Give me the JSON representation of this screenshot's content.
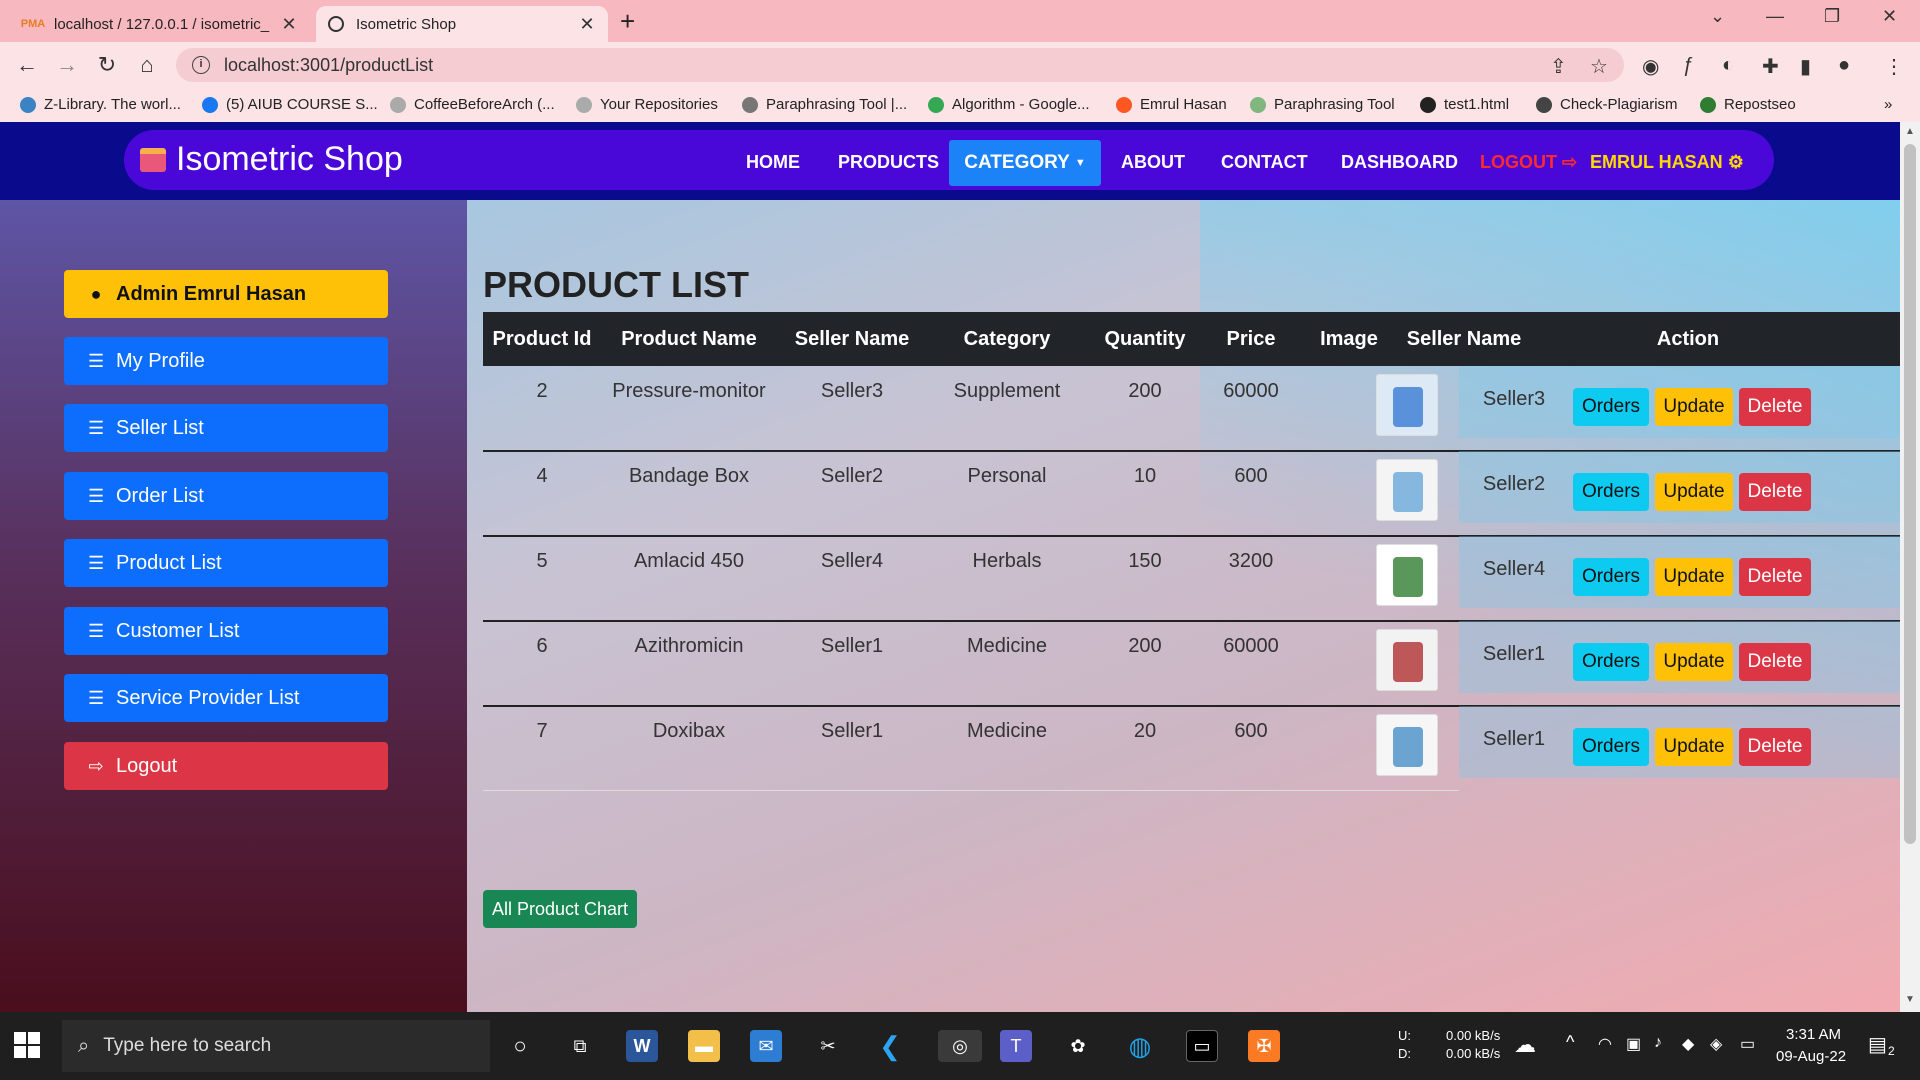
{
  "browser": {
    "tabs": [
      {
        "label": "localhost / 127.0.0.1 / isometric_",
        "favicon": "phpmyadmin-icon"
      },
      {
        "label": "Isometric Shop",
        "favicon": "react-icon"
      }
    ],
    "url": "localhost:3001/productList",
    "bookmarks": [
      {
        "label": "Z-Library. The worl...",
        "color": "#3b83c4"
      },
      {
        "label": "(5) AIUB COURSE S...",
        "color": "#1877f2"
      },
      {
        "label": "CoffeeBeforeArch (...",
        "color": "#aaaaaa"
      },
      {
        "label": "Your Repositories",
        "color": "#aaaaaa"
      },
      {
        "label": "Paraphrasing Tool |...",
        "color": "#777777"
      },
      {
        "label": "Algorithm - Google...",
        "color": "#34a853"
      },
      {
        "label": "Emrul Hasan",
        "color": "#ff5722"
      },
      {
        "label": "Paraphrasing Tool",
        "color": "#7fb77e"
      },
      {
        "label": "test1.html",
        "color": "#222222"
      },
      {
        "label": "Check-Plagiarism",
        "color": "#444444"
      },
      {
        "label": "Repostseo",
        "color": "#2e7d32"
      }
    ]
  },
  "site": {
    "brand": "Isometric Shop",
    "nav": {
      "home": "HOME",
      "products": "PRODUCTS",
      "category": "CATEGORY",
      "about": "ABOUT",
      "contact": "CONTACT",
      "dashboard": "DASHBOARD",
      "logout": "LOGOUT",
      "user": "EMRUL HASAN"
    }
  },
  "sidebar": {
    "admin": "Admin Emrul Hasan",
    "items": [
      "My Profile",
      "Seller List",
      "Order List",
      "Product List",
      "Customer List",
      "Service Provider List"
    ],
    "logout": "Logout"
  },
  "main": {
    "title": "PRODUCT LIST",
    "headers": [
      "Product Id",
      "Product Name",
      "Seller Name",
      "Category",
      "Quantity",
      "Price",
      "Image",
      "Seller Name",
      "Action"
    ],
    "rows": [
      {
        "id": "2",
        "name": "Pressure-monitor",
        "seller": "Seller3",
        "category": "Supplement",
        "quantity": "200",
        "price": "60000",
        "seller2": "Seller3"
      },
      {
        "id": "4",
        "name": "Bandage Box",
        "seller": "Seller2",
        "category": "Personal",
        "quantity": "10",
        "price": "600",
        "seller2": "Seller2"
      },
      {
        "id": "5",
        "name": "Amlacid 450",
        "seller": "Seller4",
        "category": "Herbals",
        "quantity": "150",
        "price": "3200",
        "seller2": "Seller4"
      },
      {
        "id": "6",
        "name": "Azithromicin",
        "seller": "Seller1",
        "category": "Medicine",
        "quantity": "200",
        "price": "60000",
        "seller2": "Seller1"
      },
      {
        "id": "7",
        "name": "Doxibax",
        "seller": "Seller1",
        "category": "Medicine",
        "quantity": "20",
        "price": "600",
        "seller2": "Seller1"
      }
    ],
    "actions": {
      "orders": "Orders",
      "update": "Update",
      "delete": "Delete"
    },
    "chart_button": "All Product Chart"
  },
  "taskbar": {
    "search_placeholder": "Type here to search",
    "net_up_label": "U:",
    "net_down_label": "D:",
    "net_up": "0.00 kB/s",
    "net_down": "0.00 kB/s",
    "time": "3:31 AM",
    "date": "09-Aug-22",
    "notifications": "2"
  }
}
